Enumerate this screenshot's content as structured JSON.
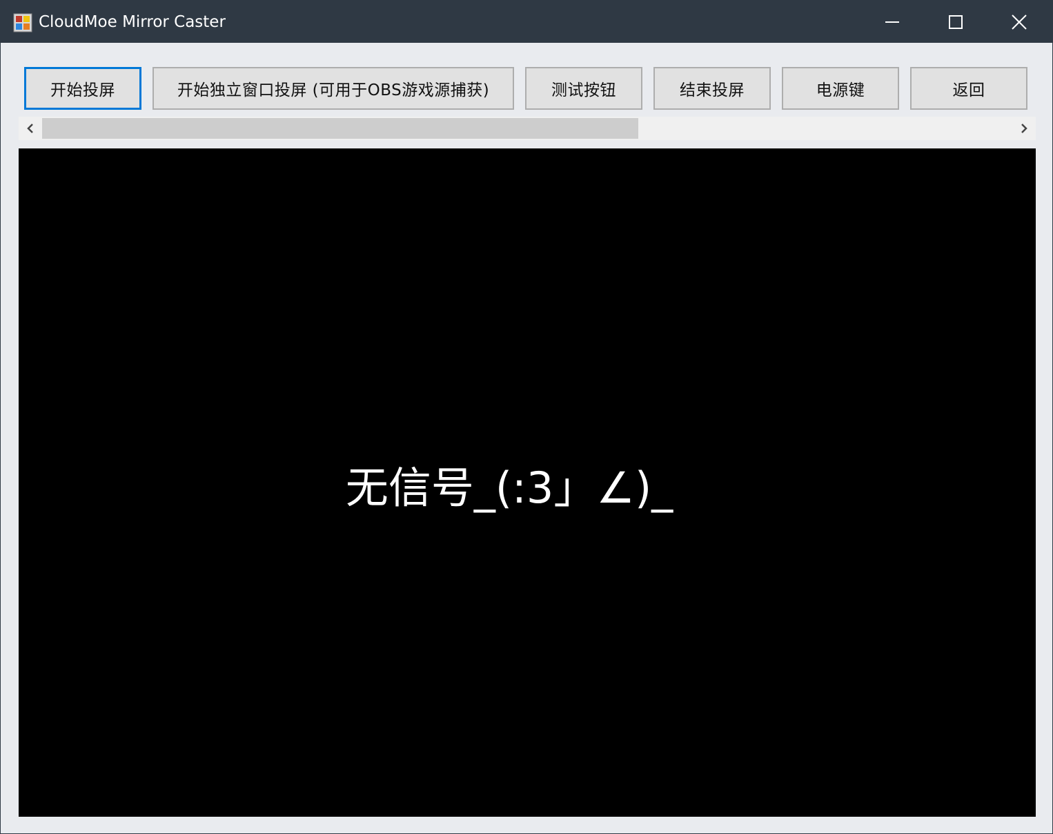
{
  "window": {
    "title": "CloudMoe Mirror Caster"
  },
  "toolbar": {
    "start_cast": "开始投屏",
    "start_window_cast": "开始独立窗口投屏 (可用于OBS游戏源捕获)",
    "test_button": "测试按钮",
    "stop_cast": "结束投屏",
    "power_key": "电源键",
    "back": "返回"
  },
  "display": {
    "status_text": "无信号_(:3」∠)_"
  },
  "icons": {
    "app": "app-icon",
    "minimize": "minimize-icon",
    "maximize": "maximize-icon",
    "close": "close-icon",
    "scroll_left": "chevron-left-icon",
    "scroll_right": "chevron-right-icon"
  },
  "colors": {
    "titlebar": "#2f3944",
    "focus_border": "#0078d7",
    "display_bg": "#000000",
    "window_bg": "#e9ebef"
  }
}
